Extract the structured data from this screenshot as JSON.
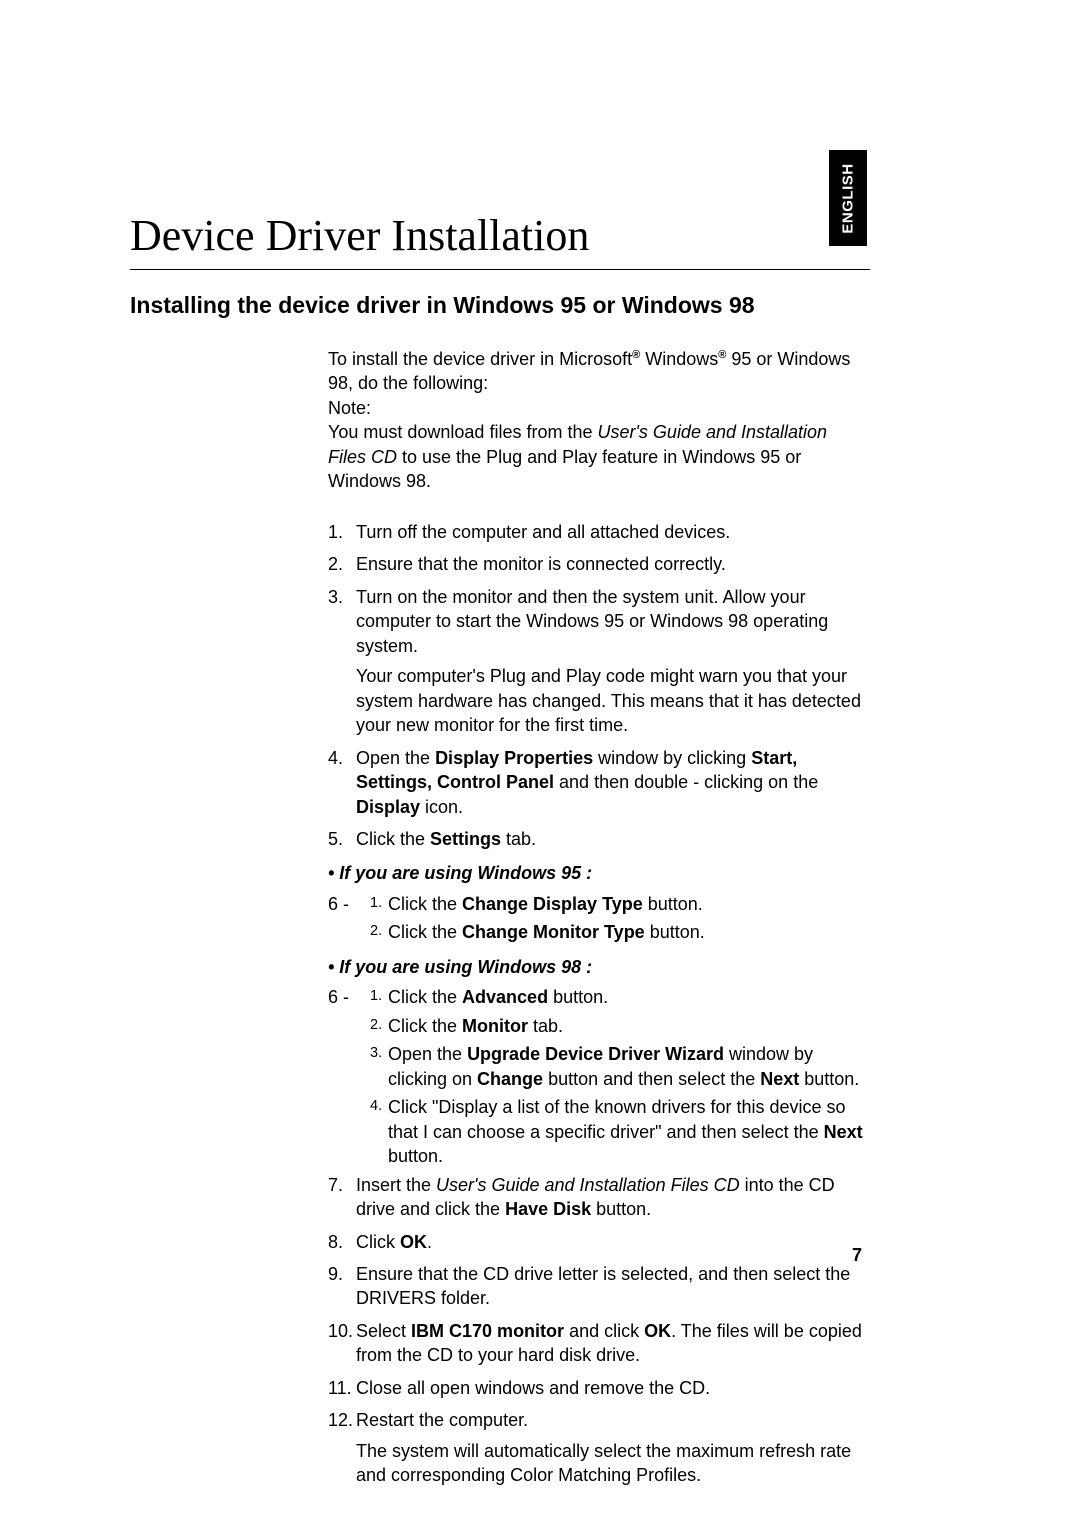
{
  "langTab": "ENGLISH",
  "title": "Device Driver Installation",
  "section": "Installing the device driver in Windows 95 or Windows 98",
  "intro": {
    "p1_a": "To install the device driver in Microsoft",
    "p1_reg1": "®",
    "p1_b": " Windows",
    "p1_reg2": "®",
    "p1_c": " 95 or Windows 98, do the following:",
    "note": "Note:",
    "p2_a": "You must download files from the ",
    "p2_i": "User's Guide and Installation Files CD",
    "p2_b": " to use the Plug and Play feature in Windows 95 or Windows 98."
  },
  "steps": {
    "s1": "Turn off the computer and all attached devices.",
    "s2": "Ensure that the monitor is connected correctly.",
    "s3a": "Turn on the monitor and then the system unit. Allow your computer to start the Windows 95 or Windows 98 operating system.",
    "s3b": "Your computer's Plug and Play code might warn you that your system hardware has changed. This means that it has detected your new monitor for the first time.",
    "s4_a": "Open the ",
    "s4_b1": "Display Properties",
    "s4_b": " window by clicking ",
    "s4_b2": "Start, Settings, Control Panel",
    "s4_c": " and then double - clicking on the ",
    "s4_b3": "Display",
    "s4_d": " icon.",
    "s5_a": "Click the ",
    "s5_b1": "Settings",
    "s5_b": " tab.",
    "bullet95": "• If you are using Windows 95 :",
    "w95_1_a": "Click the ",
    "w95_1_b1": "Change Display Type",
    "w95_1_b": " button.",
    "w95_2_a": "Click the ",
    "w95_2_b1": "Change Monitor Type",
    "w95_2_b": " button.",
    "bullet98": "• If you are using Windows 98 :",
    "w98_1_a": "Click the ",
    "w98_1_b1": "Advanced",
    "w98_1_b": " button.",
    "w98_2_a": "Click the ",
    "w98_2_b1": "Monitor",
    "w98_2_b": " tab.",
    "w98_3_a": "Open the ",
    "w98_3_b1": "Upgrade Device Driver Wizard",
    "w98_3_b": " window by clicking on ",
    "w98_3_b2": "Change",
    "w98_3_c": " button and then select the ",
    "w98_3_b3": "Next",
    "w98_3_d": " button.",
    "w98_4_a": "Click \"Display a list of the known drivers for this device so that I can choose a specific driver\" and  then select the ",
    "w98_4_b1": "Next",
    "w98_4_b": " button.",
    "s7_a": "Insert the ",
    "s7_i": "User's Guide and Installation Files CD",
    "s7_b": " into the CD drive and click the ",
    "s7_b1": "Have Disk",
    "s7_c": " button.",
    "s8_a": "Click ",
    "s8_b1": "OK",
    "s8_b": ".",
    "s9": "Ensure that the CD drive letter is selected, and then select the DRIVERS folder.",
    "s10_a": "Select ",
    "s10_b1": "IBM C170 monitor",
    "s10_b": " and click ",
    "s10_b2": "OK",
    "s10_c": ". The files will be copied from the CD to your hard disk drive.",
    "s11": "Close all open windows and remove the CD.",
    "s12": "Restart the computer.",
    "s12b": "The system will automatically select the maximum refresh rate and corresponding Color Matching Profiles."
  },
  "labels": {
    "n1": "1.",
    "n2": "2.",
    "n3": "3.",
    "n4": "4.",
    "n5": "5.",
    "n7": "7.",
    "n8": "8.",
    "n9": "9.",
    "n10": "10.",
    "n11": "11.",
    "n12": "12.",
    "six_dash": "6 - ",
    "sub1": "1.",
    "sub2": "2.",
    "sub3": "3.",
    "sub4": "4."
  },
  "pageNumber": "7"
}
